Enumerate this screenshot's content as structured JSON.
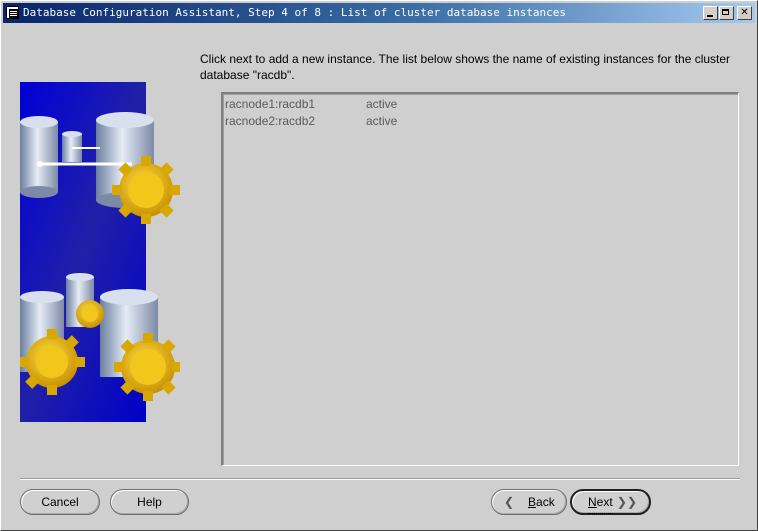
{
  "window": {
    "title": "Database Configuration Assistant, Step 4 of 8 : List of cluster database instances"
  },
  "description": "Click next to add a new instance. The list below shows the name of existing instances for the cluster database \"racdb\".",
  "instances": [
    {
      "name": "racnode1:racdb1",
      "status": "active"
    },
    {
      "name": "racnode2:racdb2",
      "status": "active"
    }
  ],
  "buttons": {
    "cancel": "Cancel",
    "help": "Help",
    "back_mnemonic": "B",
    "back_rest": "ack",
    "next_mnemonic": "N",
    "next_rest": "ext"
  },
  "icons": {
    "back": "chevron-left-icon",
    "next": "chevron-right-icon"
  },
  "colors": {
    "titlebar_start": "#0a246a",
    "titlebar_end": "#a6caf0",
    "panel_blue": "#0000cc",
    "gear_gold": "#e8b800"
  }
}
